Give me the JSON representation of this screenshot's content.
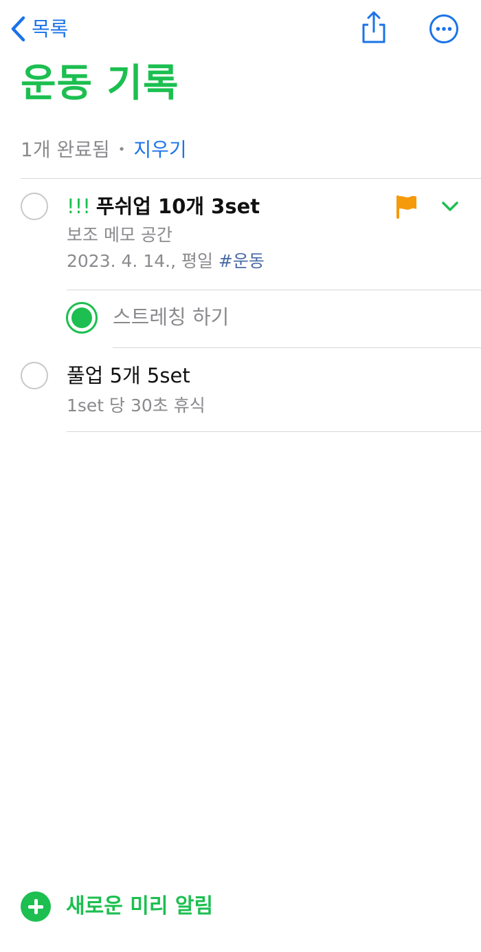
{
  "nav": {
    "back_label": "목록"
  },
  "list": {
    "title": "운동 기록",
    "completed_count": "1개 완료됨",
    "separator": "•",
    "clear_label": "지우기"
  },
  "reminders": [
    {
      "priority": "!!!",
      "title": "푸쉬업 10개 3set",
      "note": "보조 메모 공간",
      "date": "2023. 4. 14., 평일",
      "tag": "#운동",
      "flagged": true,
      "expanded": true,
      "subtasks": [
        {
          "title": "스트레칭 하기",
          "completed": true
        }
      ]
    },
    {
      "title": "풀업 5개 5set",
      "note": "1set 당 30초 휴식",
      "completed": false
    }
  ],
  "footer": {
    "new_reminder_label": "새로운 미리 알림"
  },
  "colors": {
    "accent_green": "#1cbf50",
    "link_blue": "#1a73e8",
    "flag_orange": "#f59a0b",
    "tag_blue": "#4a6aa5"
  },
  "icons": [
    "chevron-left-icon",
    "share-icon",
    "ellipsis-circle-icon",
    "flag-icon",
    "chevron-down-icon",
    "plus-circle-icon"
  ]
}
